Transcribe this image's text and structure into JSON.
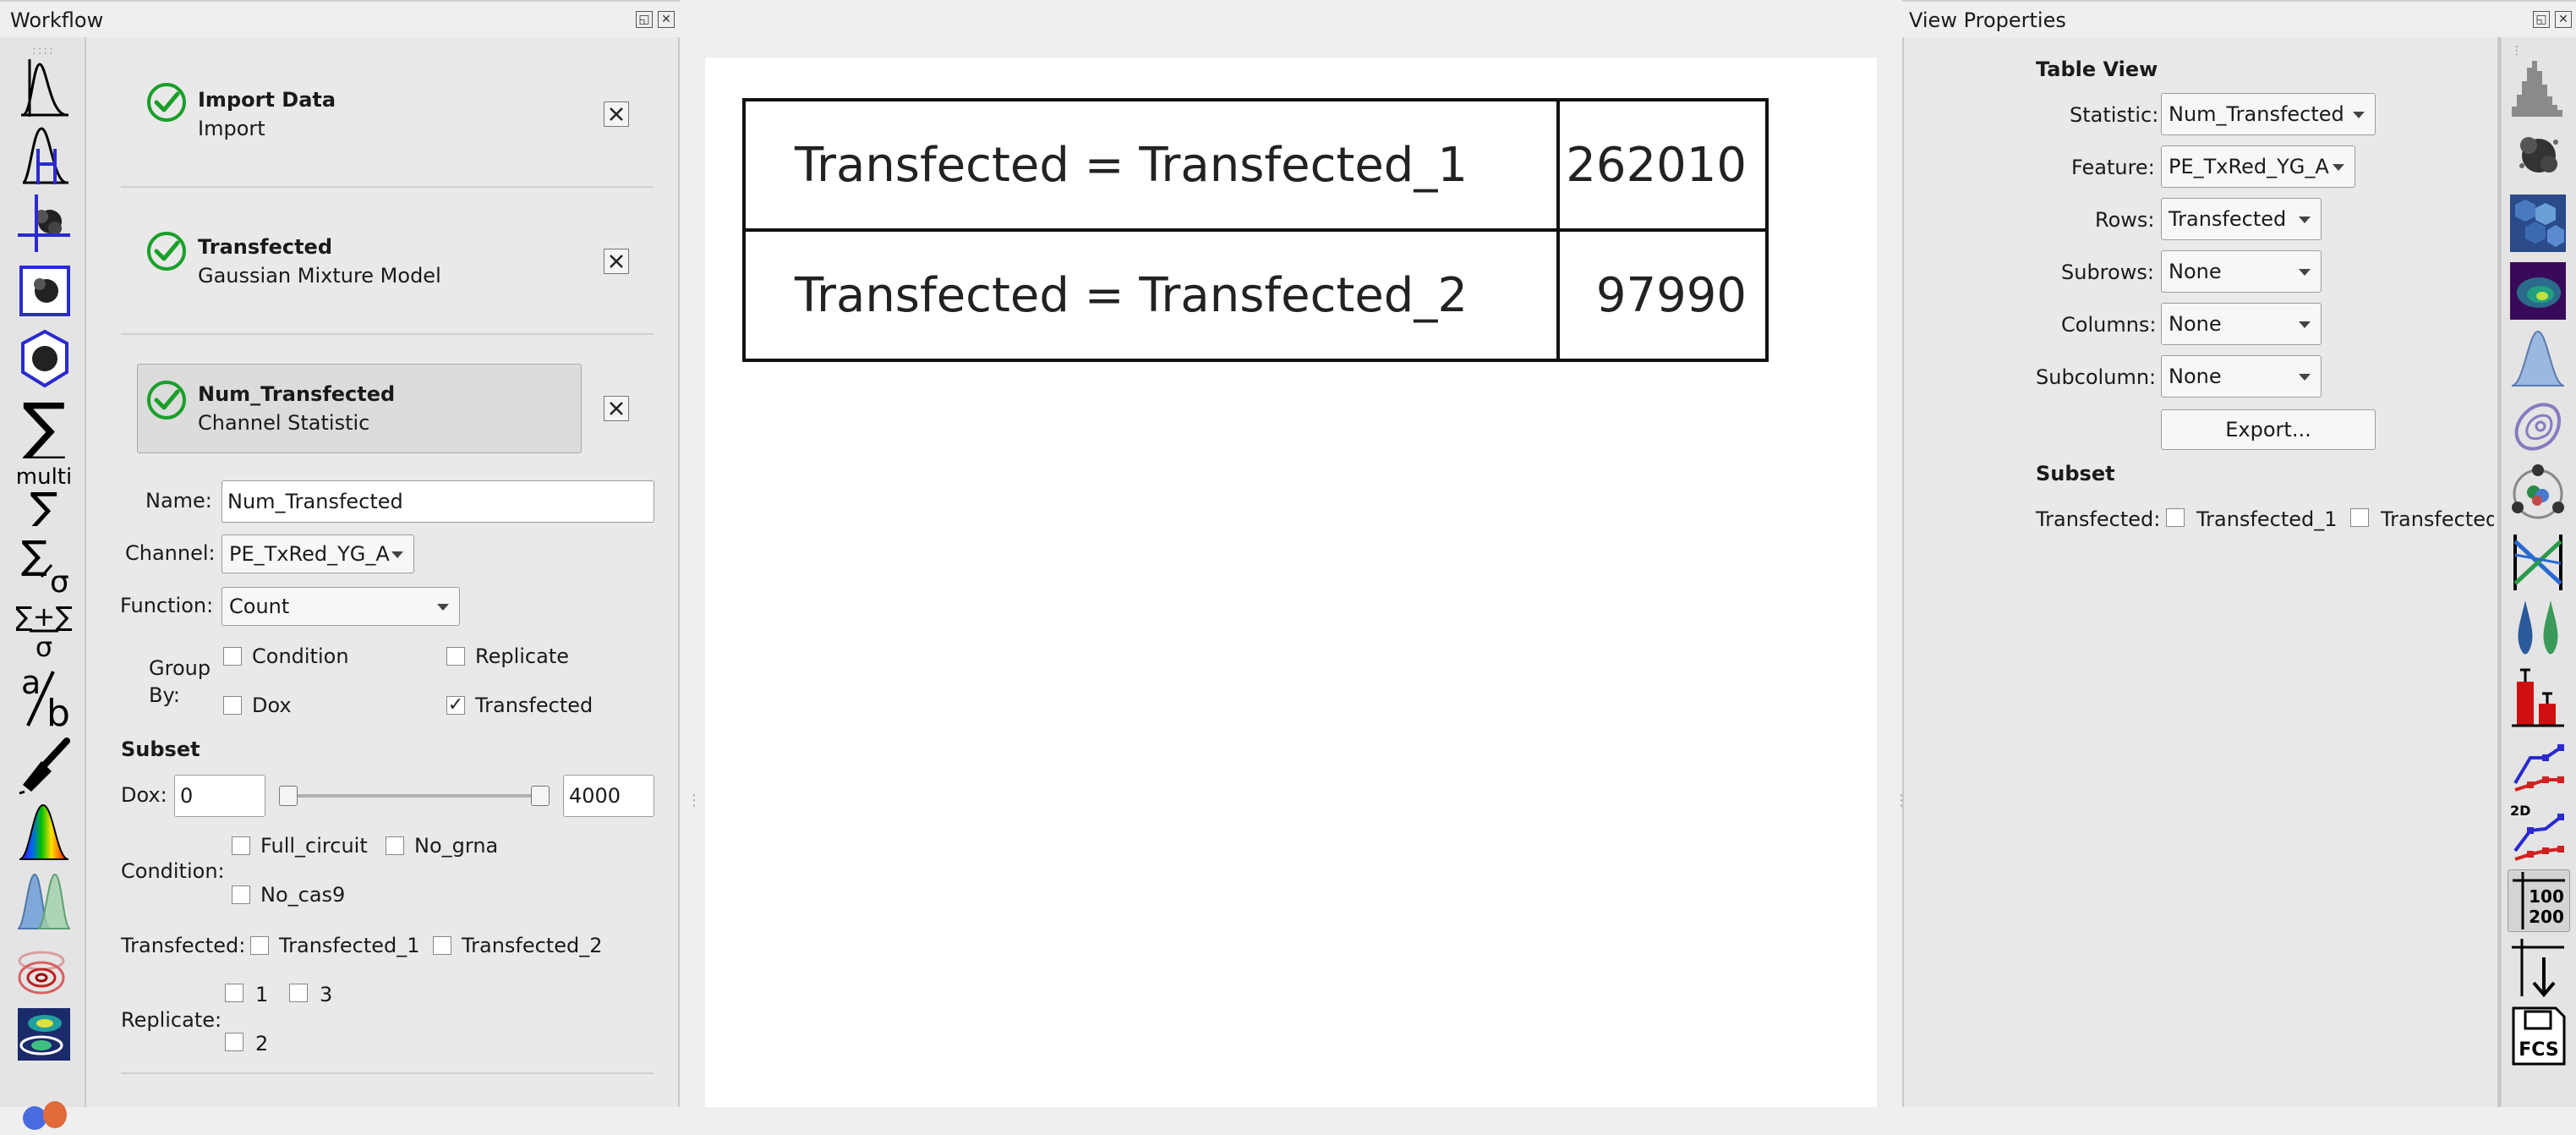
{
  "workflow_dock": {
    "title": "Workflow"
  },
  "workflow_items": [
    {
      "title": "Import Data",
      "subtitle": "Import"
    },
    {
      "title": "Transfected",
      "subtitle": "Gaussian Mixture Model"
    },
    {
      "title": "Num_Transfected",
      "subtitle": "Channel Statistic"
    }
  ],
  "op_settings": {
    "name_label": "Name:",
    "name_value": "Num_Transfected",
    "channel_label": "Channel:",
    "channel_value": "PE_TxRed_YG_A",
    "function_label": "Function:",
    "function_value": "Count",
    "group_by_label_1": "Group",
    "group_by_label_2": "By:",
    "group_by": [
      {
        "label": "Condition",
        "checked": false
      },
      {
        "label": "Replicate",
        "checked": false
      },
      {
        "label": "Dox",
        "checked": false
      },
      {
        "label": "Transfected",
        "checked": true
      }
    ],
    "subset_heading": "Subset",
    "dox_label": "Dox:",
    "dox_min": "0",
    "dox_max": "4000",
    "condition_label": "Condition:",
    "condition_options": [
      "Full_circuit",
      "No_grna",
      "No_cas9"
    ],
    "transfected_label": "Transfected:",
    "transfected_options": [
      "Transfected_1",
      "Transfected_2"
    ],
    "replicate_label": "Replicate:",
    "replicate_options": [
      "1",
      "3",
      "2"
    ]
  },
  "table_view": {
    "rows": [
      {
        "key": "Transfected = Transfected_1",
        "value": "262010"
      },
      {
        "key": "Transfected = Transfected_2",
        "value": "97990"
      }
    ]
  },
  "view_props": {
    "dock_title": "View Properties",
    "heading": "Table View",
    "statistic_label": "Statistic:",
    "statistic_value": "Num_Transfected",
    "feature_label": "Feature:",
    "feature_value": "PE_TxRed_YG_A",
    "rows_label": "Rows:",
    "rows_value": "Transfected",
    "subrows_label": "Subrows:",
    "subrows_value": "None",
    "columns_label": "Columns:",
    "columns_value": "None",
    "subcolumn_label": "Subcolumn:",
    "subcolumn_value": "None",
    "export_label": "Export...",
    "subset_heading": "Subset",
    "transfected_label": "Transfected:",
    "transfected_options": [
      "Transfected_1",
      "Transfected_"
    ]
  },
  "left_toolbar_icons": [
    "histogram-icon",
    "stacked-histogram-icon",
    "quadrant-gate-icon",
    "range-2d-gate-icon",
    "polygon-gate-icon",
    "sum-icon",
    "multi-sum-icon",
    "sum-sigma-icon",
    "sum-plus-sum-sigma-icon",
    "ratio-icon",
    "brush-icon",
    "spectrum-icon",
    "gaussian-1d-icon",
    "density-contour-icon",
    "gaussian-2d-icon",
    "scatter-colors-icon"
  ],
  "right_toolbar_icons": [
    "histogram-view-icon",
    "scatterplot-icon",
    "hexbin-icon",
    "density-icon",
    "kde-1d-icon",
    "kde-2d-icon",
    "radviz-icon",
    "parallel-coords-icon",
    "violin-icon",
    "bar-chart-icon",
    "stats-1d-icon",
    "stats-2d-icon",
    "table-view-icon",
    "export-icon",
    "fcs-export-icon"
  ],
  "right_toolbar_text": {
    "stats2d": "2D",
    "table_a": "100",
    "table_b": "200",
    "fcs": "FCS"
  },
  "colors": {
    "check_green": "#1a9f2a",
    "selection_blue": "#2222cc"
  }
}
